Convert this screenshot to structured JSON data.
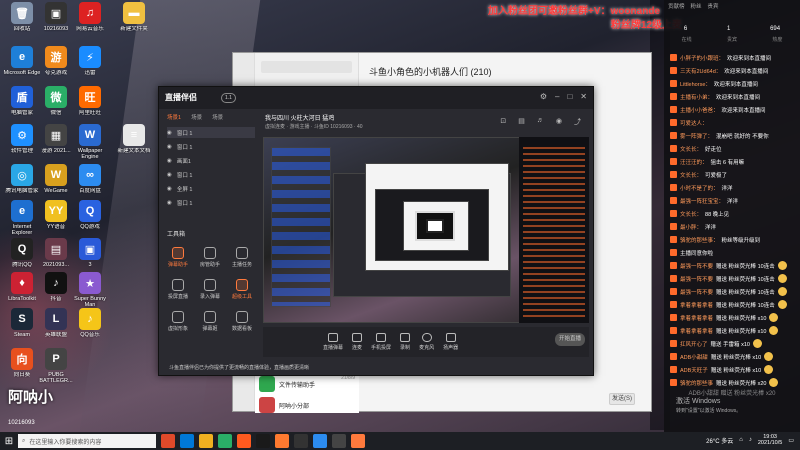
{
  "overlay": {
    "line1": "加入粉丝团可邀粉丝群+V：woonande",
    "line2": "粉丝牌12级上麦"
  },
  "desktop_icons": [
    {
      "label": "回收站",
      "color": "#7d8fa8",
      "glyph": "🗑"
    },
    {
      "label": "Microsoft Edge",
      "color": "#1e7fd8",
      "glyph": "e"
    },
    {
      "label": "电脑管家",
      "color": "#2060d8",
      "glyph": "盾"
    },
    {
      "label": "软件管理",
      "color": "#1e90ff",
      "glyph": "⚙"
    },
    {
      "label": "腾讯电脑管家",
      "color": "#2aa7e6",
      "glyph": "◎"
    },
    {
      "label": "Internet Explorer",
      "color": "#1e6fd0",
      "glyph": "e"
    },
    {
      "label": "腾讯QQ",
      "color": "#222",
      "glyph": "Q"
    },
    {
      "label": "LibraToolkit",
      "color": "#cc2233",
      "glyph": "♦"
    },
    {
      "label": "Steam",
      "color": "#1b2838",
      "glyph": "S"
    },
    {
      "label": "向日葵",
      "color": "#e8501e",
      "glyph": "向"
    },
    {
      "label": "10216093",
      "color": "#333",
      "glyph": "▣"
    },
    {
      "label": "夸克游戏",
      "color": "#f08a1c",
      "glyph": "游"
    },
    {
      "label": "微信",
      "color": "#2aae67",
      "glyph": "微"
    },
    {
      "label": "漫游 2021...",
      "color": "#444",
      "glyph": "▦"
    },
    {
      "label": "WeGame",
      "color": "#d8a01e",
      "glyph": "W"
    },
    {
      "label": "YY语音",
      "color": "#f0c020",
      "glyph": "YY"
    },
    {
      "label": "2021093...",
      "color": "#6a3a4a",
      "glyph": "▤"
    },
    {
      "label": "抖音",
      "color": "#111",
      "glyph": "♪"
    },
    {
      "label": "英雄联盟",
      "color": "#335",
      "glyph": "L"
    },
    {
      "label": "PUBG BATTLEGR...",
      "color": "#444",
      "glyph": "P"
    },
    {
      "label": "网易云音乐",
      "color": "#dd2222",
      "glyph": "♫"
    },
    {
      "label": "迅雷",
      "color": "#1a8cff",
      "glyph": "⚡"
    },
    {
      "label": "阿里旺旺",
      "color": "#ff6a00",
      "glyph": "旺"
    },
    {
      "label": "Wallpaper Engine",
      "color": "#2a6ad0",
      "glyph": "W"
    },
    {
      "label": "百度网盘",
      "color": "#2c8cf0",
      "glyph": "∞"
    },
    {
      "label": "QQ游戏",
      "color": "#2a62e0",
      "glyph": "Q"
    },
    {
      "label": "3",
      "color": "#2a5ad8",
      "glyph": "▣"
    },
    {
      "label": "Super Bunny Man",
      "color": "#8a5ad0",
      "glyph": "★"
    },
    {
      "label": "QQ音乐",
      "color": "#f5c518",
      "glyph": "♪"
    },
    {
      "label": "新建文本文档",
      "color": "#e8e8e8",
      "glyph": "≡"
    },
    {
      "label": "新建文件夹",
      "color": "#f0c040",
      "glyph": "▬"
    }
  ],
  "chat_window": {
    "title": "斗鱼小角色的小机器人们 (210)",
    "send_label": "发送(S)",
    "items": [
      {
        "name": "文件传输助手",
        "time": "21/8/9"
      },
      {
        "name": "阿呐小分部",
        "time": ""
      }
    ]
  },
  "stream_app": {
    "logo": "直播伴侣",
    "version": "1.1",
    "scene_tabs": [
      "场景1",
      "场景",
      "场景"
    ],
    "sources": [
      {
        "name": "窗口 1",
        "selected": true
      },
      {
        "name": "窗口 1",
        "selected": false
      },
      {
        "name": "画面1",
        "selected": false
      },
      {
        "name": "窗口 1",
        "selected": false
      },
      {
        "name": "全屏 1",
        "selected": false
      },
      {
        "name": "窗口 1",
        "selected": false
      }
    ],
    "tools_title": "工具箱",
    "tools": [
      {
        "label": "弹幕助手",
        "hl": true
      },
      {
        "label": "房管助手",
        "hl": false
      },
      {
        "label": "主播任务",
        "hl": false
      },
      {
        "label": "投屏直播",
        "hl": false
      },
      {
        "label": "录入弹幕",
        "hl": false
      },
      {
        "label": "超级工具",
        "hl": true
      },
      {
        "label": "虚拟形象",
        "hl": false
      },
      {
        "label": "弹幕姬",
        "hl": false
      },
      {
        "label": "数据看板",
        "hl": false
      }
    ],
    "room_title": "我与四川 火柱大河日 猛鸡",
    "room_sub": "虚拟连麦 · 游戏主播 · 斗鱼ID 10216093 · 40",
    "bottom_buttons": [
      "直播弹幕",
      "连麦",
      "手机投屏",
      "录制",
      "麦克风",
      "扬声器"
    ],
    "start_label": "开始直播",
    "notice": "斗鱼直播伴侣已为你提供了更流畅的直播体验，直播画质更清晰"
  },
  "live_panel": {
    "top_tabs": [
      "贡献榜",
      "粉丝",
      "贵宾"
    ],
    "stats": [
      "6",
      "1",
      "694"
    ],
    "stat_labels": [
      "在线",
      "贵宾",
      "热度"
    ],
    "messages": [
      {
        "user": "小胖子的小跟班",
        "text": "欢迎来到本直播间",
        "gift": false
      },
      {
        "user": "三天有2Ud64d",
        "text": "欢迎来到本直播间",
        "gift": false
      },
      {
        "user": "Littlehorse",
        "text": "欢迎来到本直播间",
        "gift": false
      },
      {
        "user": "主播有小弟",
        "text": "欢迎来到本直播间",
        "gift": false
      },
      {
        "user": "主播小小爸爸",
        "text": "欢迎来到本直播间",
        "gift": false
      },
      {
        "user": "可爱达人",
        "text": "",
        "gift": false
      },
      {
        "user": "雾一阵弹了",
        "text": "混崩吧 就好的 不要你",
        "gift": false
      },
      {
        "user": "文长长",
        "text": "好走位",
        "gift": false
      },
      {
        "user": "汪汪汪的",
        "text": "狙击 6 有用嘛",
        "gift": false
      },
      {
        "user": "文长长",
        "text": "可爱极了",
        "gift": false
      },
      {
        "user": "小时不是了的",
        "text": "洋洋",
        "gift": false
      },
      {
        "user": "最强一阵狂宝宝",
        "text": "洋洋",
        "gift": false
      },
      {
        "user": "文长长",
        "text": "88 晚上见",
        "gift": false
      },
      {
        "user": "最小胖",
        "text": "洋洋",
        "gift": false
      },
      {
        "user": "骆驼的那些事",
        "text": "粉丝等级升级到",
        "gift": false
      },
      {
        "user": "",
        "text": "主播同意你啦",
        "gift": false
      },
      {
        "user": "最强一阵不要",
        "text": "赠送 粉丝荧光棒 10连击",
        "gift": true
      },
      {
        "user": "最强一阵不要",
        "text": "赠送 粉丝荧光棒 10连击",
        "gift": true
      },
      {
        "user": "最强一阵不要",
        "text": "赠送 粉丝荧光棒 10连击",
        "gift": true
      },
      {
        "user": "拿着拿着拿着",
        "text": "赠送 粉丝荧光棒 10连击",
        "gift": true
      },
      {
        "user": "拿着拿着拿着",
        "text": "赠送 粉丝荧光棒 x10",
        "gift": true
      },
      {
        "user": "拿着拿着拿着",
        "text": "赠送 粉丝荧光棒 x10",
        "gift": true
      },
      {
        "user": "扛风开心了",
        "text": "赠送 手雷箱 x10",
        "gift": true
      },
      {
        "user": "ADB小甜甜",
        "text": "赠送 粉丝荧光棒 x10",
        "gift": true
      },
      {
        "user": "ADB天旺子",
        "text": "赠送 粉丝荧光棒 x10",
        "gift": true
      },
      {
        "user": "骆驼的那些事",
        "text": "赠送 粉丝荧光棒 x20",
        "gift": true
      }
    ],
    "watermark": "ADB小甜甜 赠送 粉丝荧光棒 x20"
  },
  "id_overlay": {
    "name": "阿呐小",
    "id": "10216093"
  },
  "activate": {
    "line1": "激活 Windows",
    "line2": "转到\"设置\"以激活 Windows。"
  },
  "taskbar": {
    "search_placeholder": "在这里输入你要搜索的内容",
    "app_colors": [
      "#e04a2a",
      "#0078d7",
      "#f0b020",
      "#2aae67",
      "#ff5a1f",
      "#1a1a1a",
      "#ff7a30",
      "#333",
      "#2c8cf0",
      "#444",
      "#ff7a3d"
    ],
    "weather": "26°C 多云",
    "time": "19:03",
    "date": "2021/10/5"
  }
}
